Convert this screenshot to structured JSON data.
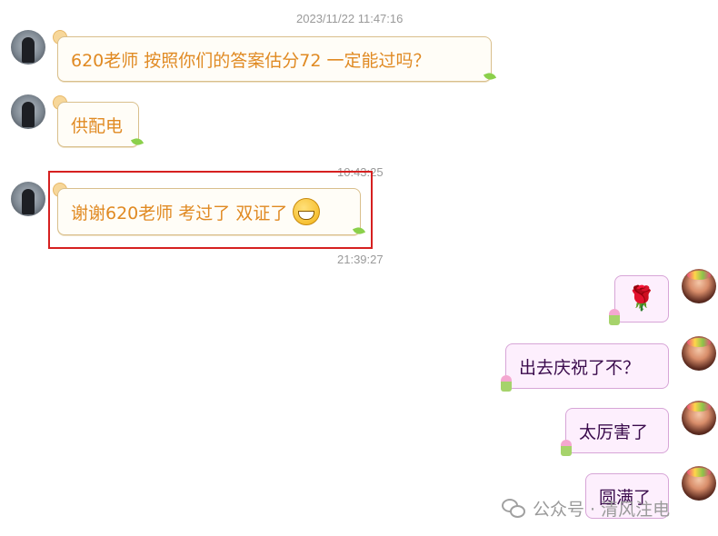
{
  "messages": {
    "ts1": "2023/11/22 11:47:16",
    "m1": "620老师 按照你们的答案估分72 一定能过吗？",
    "m2": "供配电",
    "ts2": "10:43:25",
    "m3": "谢谢620老师 考过了 双证了",
    "ts3": "21:39:27",
    "m4_icon": "rose-emoji",
    "m5": "出去庆祝了不？",
    "m6": "太厉害了",
    "m7": "圆满了"
  },
  "watermark": {
    "text": "公众号 · 清风注电",
    "icon": "wechat-icon"
  },
  "colors": {
    "left_text": "#e08a23",
    "right_text": "#3a0b4c",
    "highlight": "#d62020"
  }
}
